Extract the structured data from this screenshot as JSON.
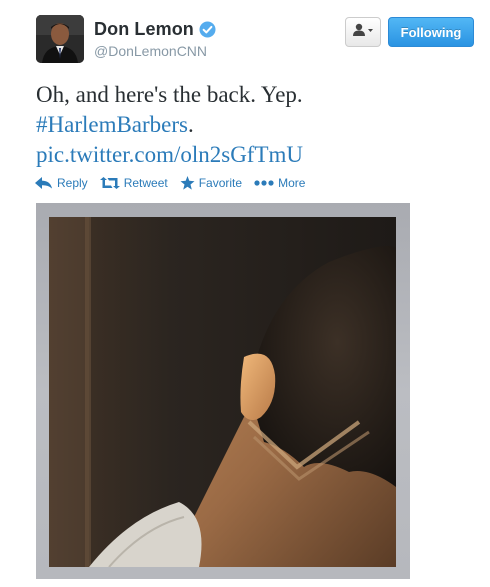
{
  "user": {
    "display_name": "Don Lemon",
    "handle": "@DonLemonCNN",
    "verified": true,
    "avatar_icon": "user-avatar-photo",
    "verified_icon": "verified-badge-icon"
  },
  "header": {
    "dropdown_icon": "user-actions-icon",
    "following_label": "Following"
  },
  "tweet": {
    "text_line_1": "Oh, and here's the back. Yep.",
    "hashtag": "#HarlemBarbers",
    "hashtag_suffix": ".",
    "link": "pic.twitter.com/oln2sGfTmU"
  },
  "actions": [
    {
      "label": "Reply",
      "icon": "reply-icon"
    },
    {
      "label": "Retweet",
      "icon": "retweet-icon"
    },
    {
      "label": "Favorite",
      "icon": "star-icon"
    },
    {
      "label": "More",
      "icon": "more-dots-icon"
    }
  ],
  "colors": {
    "link": "#2b7bb9",
    "following_button": "#2a93e2",
    "verified": "#55acee",
    "text": "#292f33",
    "secondary_text": "#8899a6"
  },
  "media": {
    "type": "photo",
    "icon": "haircut-photo"
  }
}
